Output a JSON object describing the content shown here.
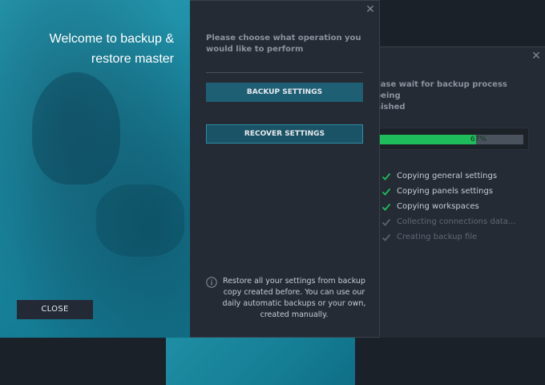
{
  "main_dialog": {
    "hero_title": "Welcome to backup & restore master",
    "close_label": "CLOSE",
    "prompt": "Please choose what operation you would like to perform",
    "backup_label": "BACKUP SETTINGS",
    "recover_label": "RECOVER SETTINGS",
    "info_text": "Restore all your settings from backup copy created before. You can use our daily automatic backups or your own, created manually.",
    "close_icon": "close-icon",
    "info_icon": "info-icon"
  },
  "progress_dialog": {
    "title": "ease wait for backup process being nished",
    "progress_percent": 67,
    "progress_label": "67%",
    "close_icon": "close-icon",
    "steps": [
      {
        "label": "Copying general settings",
        "done": true
      },
      {
        "label": "Copying panels settings",
        "done": true
      },
      {
        "label": "Copying workspaces",
        "done": true
      },
      {
        "label": "Collecting connections data...",
        "done": false
      },
      {
        "label": "Creating backup file",
        "done": false
      }
    ]
  },
  "colors": {
    "accent": "#1e5f74",
    "progress": "#1ebc5b",
    "check": "#1ebc5b",
    "hero": "#1a89a1"
  }
}
